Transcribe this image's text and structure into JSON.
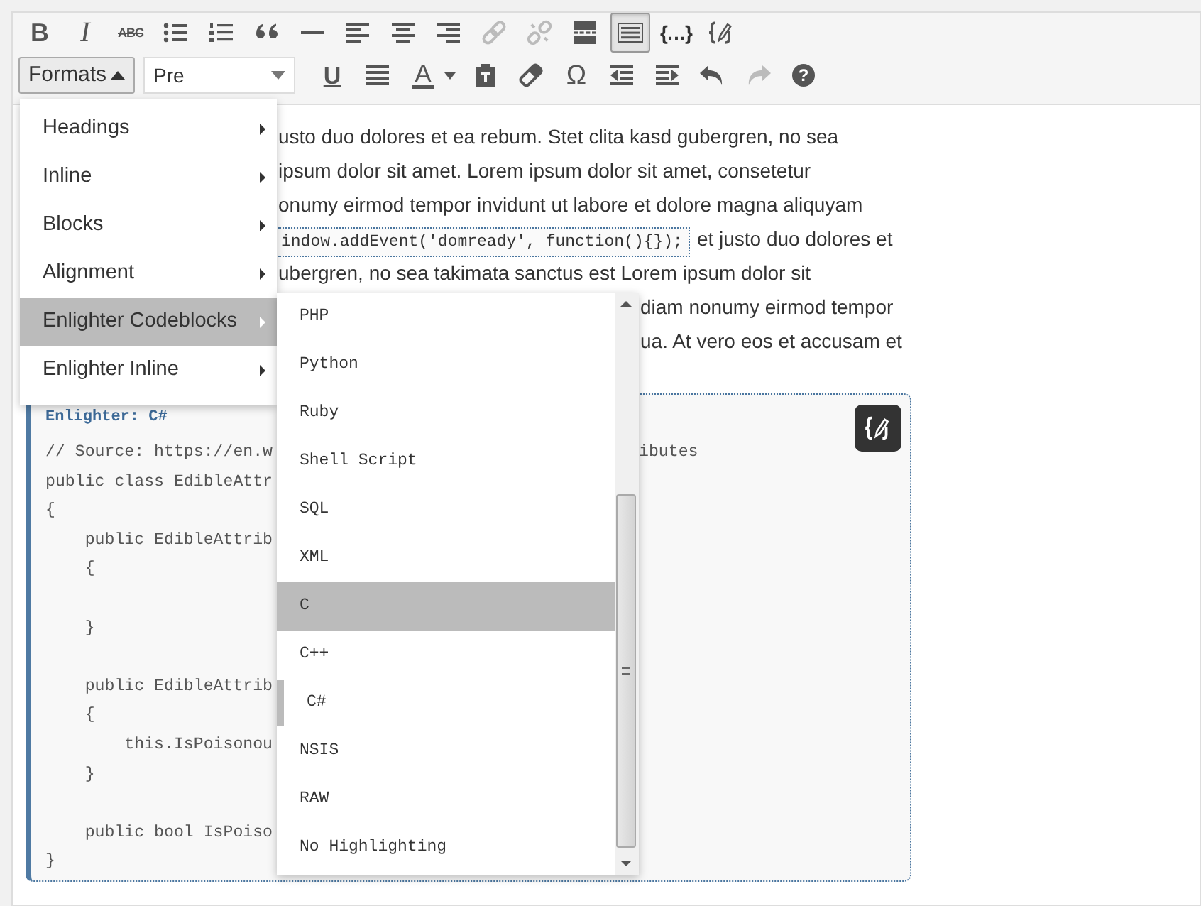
{
  "toolbar_row_1": [
    {
      "kind": "bold",
      "glyph": "B",
      "active": false,
      "disabled": false
    },
    {
      "kind": "italic",
      "glyph": "I",
      "active": false,
      "disabled": false
    },
    {
      "kind": "strikethrough",
      "glyph": "ABC",
      "active": false,
      "disabled": false
    },
    {
      "kind": "bullet_list",
      "active": false,
      "disabled": false
    },
    {
      "kind": "numbered_list",
      "active": false,
      "disabled": false
    },
    {
      "kind": "blockquote",
      "active": false,
      "disabled": false
    },
    {
      "kind": "horizontal_rule",
      "active": false,
      "disabled": false
    },
    {
      "kind": "align_left",
      "active": false,
      "disabled": false
    },
    {
      "kind": "align_center",
      "active": false,
      "disabled": false
    },
    {
      "kind": "align_right",
      "active": false,
      "disabled": false
    },
    {
      "kind": "link",
      "active": false,
      "disabled": true
    },
    {
      "kind": "unlink",
      "active": false,
      "disabled": true
    },
    {
      "kind": "read_more",
      "active": false,
      "disabled": false
    },
    {
      "kind": "toolbar_toggle",
      "active": true,
      "disabled": false
    },
    {
      "kind": "code",
      "glyph": "{…}",
      "active": false,
      "disabled": false
    },
    {
      "kind": "edit_code",
      "active": false,
      "disabled": false
    }
  ],
  "formats_button": {
    "label": "Formats",
    "expanded": true
  },
  "block_format_select": {
    "value": "Pre"
  },
  "toolbar_row_2": [
    {
      "kind": "underline",
      "glyph": "U",
      "active": false,
      "disabled": false
    },
    {
      "kind": "justify",
      "active": false,
      "disabled": false
    },
    {
      "kind": "text_color",
      "glyph": "A",
      "active": false,
      "disabled": false
    },
    {
      "kind": "caret",
      "active": false,
      "disabled": false
    },
    {
      "kind": "paste_text",
      "active": false,
      "disabled": false
    },
    {
      "kind": "clear_formatting",
      "active": false,
      "disabled": false
    },
    {
      "kind": "special_character",
      "glyph": "Ω",
      "active": false,
      "disabled": false
    },
    {
      "kind": "outdent",
      "active": false,
      "disabled": false
    },
    {
      "kind": "indent",
      "active": false,
      "disabled": false
    },
    {
      "kind": "undo",
      "active": false,
      "disabled": false
    },
    {
      "kind": "redo",
      "active": false,
      "disabled": true
    },
    {
      "kind": "help",
      "glyph": "?",
      "active": false,
      "disabled": false
    }
  ],
  "paragraph_lines_beside_menu": [
    [
      {
        "kind": "text",
        "text": "usto duo dolores et ea rebum. Stet clita kasd gubergren, no sea"
      }
    ],
    [
      {
        "kind": "text",
        "text": "ipsum dolor sit amet. Lorem ipsum dolor sit amet, consetetur"
      }
    ],
    [
      {
        "kind": "text",
        "text": "onumy eirmod tempor invidunt ut labore et dolore magna aliquyam"
      }
    ],
    [
      {
        "kind": "code",
        "text": "indow.addEvent('domready', function(){});"
      },
      {
        "kind": "text",
        "text": "et justo duo dolores et"
      }
    ],
    [
      {
        "kind": "text",
        "text": "ubergren, no sea takimata sanctus est Lorem ipsum dolor sit"
      }
    ]
  ],
  "paragraph_lines_beside_submenu": [
    "diam nonumy eirmod tempor",
    "ua. At vero eos et accusam et"
  ],
  "code_block": {
    "title": "Enlighter: C#",
    "lines": [
      {
        "kind": "code",
        "left": "// Source: https://en.w",
        "right": "ibutes"
      },
      {
        "kind": "code",
        "left": "public class EdibleAttr"
      },
      {
        "kind": "code",
        "left": "{"
      },
      {
        "kind": "code",
        "left": "    public EdibleAttrib"
      },
      {
        "kind": "code",
        "left": "    {"
      },
      {
        "kind": "blank"
      },
      {
        "kind": "code",
        "left": "    }"
      },
      {
        "kind": "blank"
      },
      {
        "kind": "code",
        "left": "    public EdibleAttrib"
      },
      {
        "kind": "code",
        "left": "    {"
      },
      {
        "kind": "code",
        "left": "        this.IsPoisonou"
      },
      {
        "kind": "code",
        "left": "    }"
      },
      {
        "kind": "blank"
      },
      {
        "kind": "code",
        "left": "    public bool IsPoiso"
      },
      {
        "kind": "code",
        "left": "}"
      }
    ]
  },
  "formats_menu": {
    "items": [
      {
        "label": "Headings",
        "selected": false,
        "has_submenu": true
      },
      {
        "label": "Inline",
        "selected": false,
        "has_submenu": true
      },
      {
        "label": "Blocks",
        "selected": false,
        "has_submenu": true
      },
      {
        "label": "Alignment",
        "selected": false,
        "has_submenu": true
      },
      {
        "label": "Enlighter Codeblocks",
        "selected": true,
        "has_submenu": true
      },
      {
        "label": "Enlighter Inline",
        "selected": false,
        "has_submenu": true
      }
    ]
  },
  "language_submenu": {
    "items": [
      {
        "label": "PHP",
        "selected": false,
        "current": false
      },
      {
        "label": "Python",
        "selected": false,
        "current": false
      },
      {
        "label": "Ruby",
        "selected": false,
        "current": false
      },
      {
        "label": "Shell Script",
        "selected": false,
        "current": false
      },
      {
        "label": "SQL",
        "selected": false,
        "current": false
      },
      {
        "label": "XML",
        "selected": false,
        "current": false
      },
      {
        "label": "C",
        "selected": true,
        "current": false
      },
      {
        "label": "C++",
        "selected": false,
        "current": false
      },
      {
        "label": "C#",
        "selected": false,
        "current": true
      },
      {
        "label": "NSIS",
        "selected": false,
        "current": false
      },
      {
        "label": "RAW",
        "selected": false,
        "current": false
      },
      {
        "label": "No Highlighting",
        "selected": false,
        "current": false
      }
    ]
  }
}
